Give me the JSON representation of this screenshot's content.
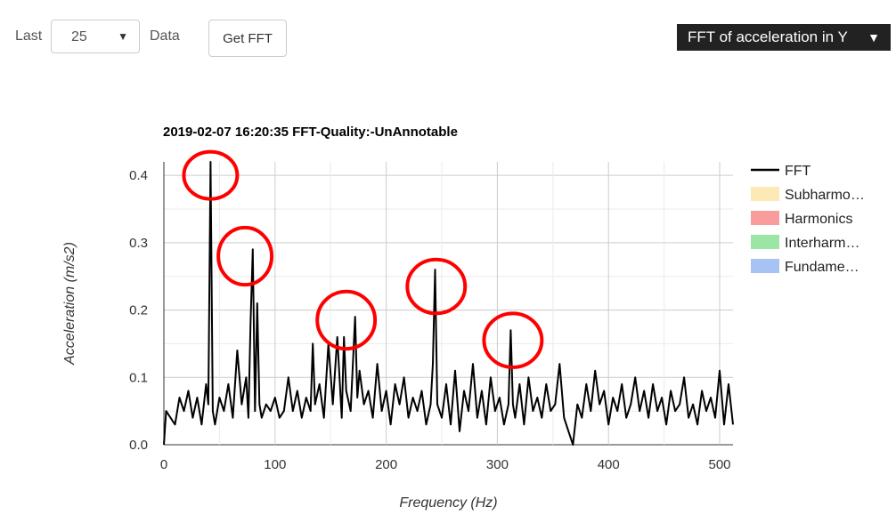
{
  "toolbar": {
    "last_label": "Last",
    "count_value": "25",
    "data_label": "Data",
    "get_fft_label": "Get FFT",
    "view_selector_label": "FFT of acceleration in Y"
  },
  "chart_data": {
    "type": "line",
    "title": "2019-02-07 16:20:35 FFT-Quality:-UnAnnotable",
    "xlabel": "Frequency (Hz)",
    "ylabel": "Acceleration (m/s2)",
    "xlim": [
      0,
      512
    ],
    "ylim": [
      0,
      0.42
    ],
    "xticks": [
      0,
      100,
      200,
      300,
      400,
      500
    ],
    "xtick_labels": [
      "0",
      "100",
      "200",
      "300",
      "400",
      "500"
    ],
    "yticks": [
      0.0,
      0.1,
      0.2,
      0.3,
      0.4
    ],
    "ytick_labels": [
      "0.0",
      "0.1",
      "0.2",
      "0.3",
      "0.4"
    ],
    "grid": true,
    "legend_position": "right",
    "legend": [
      {
        "name": "FFT",
        "kind": "line",
        "color": "#000000"
      },
      {
        "name": "Subharmo…",
        "kind": "box",
        "color": "#fde9b6"
      },
      {
        "name": "Harmonics",
        "kind": "box",
        "color": "#fb9c9c"
      },
      {
        "name": "Interharm…",
        "kind": "box",
        "color": "#9be6a5"
      },
      {
        "name": "Fundame…",
        "kind": "box",
        "color": "#a7c3f3"
      }
    ],
    "series": [
      {
        "name": "FFT",
        "color": "#000000",
        "x": [
          0,
          2,
          6,
          10,
          14,
          18,
          22,
          26,
          30,
          34,
          38,
          40,
          42,
          44,
          46,
          50,
          54,
          58,
          62,
          66,
          70,
          74,
          76,
          78,
          80,
          82,
          84,
          86,
          88,
          92,
          96,
          100,
          104,
          108,
          112,
          116,
          120,
          124,
          128,
          132,
          134,
          136,
          140,
          144,
          148,
          152,
          156,
          160,
          162,
          164,
          168,
          172,
          174,
          176,
          180,
          184,
          188,
          192,
          196,
          200,
          204,
          208,
          212,
          216,
          220,
          224,
          228,
          232,
          236,
          240,
          242,
          244,
          246,
          250,
          254,
          258,
          262,
          266,
          270,
          274,
          278,
          282,
          286,
          290,
          294,
          298,
          302,
          306,
          310,
          312,
          314,
          316,
          320,
          324,
          328,
          332,
          336,
          340,
          344,
          348,
          352,
          356,
          360,
          364,
          368,
          372,
          376,
          380,
          384,
          388,
          392,
          396,
          400,
          404,
          408,
          412,
          416,
          420,
          424,
          428,
          432,
          436,
          440,
          444,
          448,
          452,
          456,
          460,
          464,
          468,
          472,
          476,
          480,
          484,
          488,
          492,
          496,
          500,
          504,
          508,
          512
        ],
        "values": [
          0.0,
          0.05,
          0.04,
          0.03,
          0.07,
          0.05,
          0.08,
          0.04,
          0.07,
          0.03,
          0.09,
          0.06,
          0.42,
          0.05,
          0.03,
          0.07,
          0.05,
          0.09,
          0.04,
          0.14,
          0.06,
          0.1,
          0.04,
          0.18,
          0.29,
          0.05,
          0.21,
          0.06,
          0.04,
          0.06,
          0.05,
          0.07,
          0.04,
          0.05,
          0.1,
          0.05,
          0.08,
          0.04,
          0.07,
          0.05,
          0.15,
          0.06,
          0.09,
          0.04,
          0.15,
          0.06,
          0.16,
          0.04,
          0.16,
          0.08,
          0.05,
          0.19,
          0.07,
          0.11,
          0.06,
          0.08,
          0.04,
          0.12,
          0.05,
          0.08,
          0.03,
          0.09,
          0.06,
          0.1,
          0.04,
          0.07,
          0.05,
          0.08,
          0.03,
          0.06,
          0.12,
          0.26,
          0.06,
          0.04,
          0.09,
          0.03,
          0.11,
          0.02,
          0.08,
          0.05,
          0.12,
          0.04,
          0.08,
          0.03,
          0.1,
          0.05,
          0.07,
          0.03,
          0.06,
          0.17,
          0.06,
          0.04,
          0.09,
          0.03,
          0.1,
          0.05,
          0.07,
          0.04,
          0.09,
          0.05,
          0.06,
          0.12,
          0.04,
          0.02,
          0.0,
          0.06,
          0.04,
          0.09,
          0.05,
          0.11,
          0.06,
          0.08,
          0.03,
          0.07,
          0.05,
          0.09,
          0.04,
          0.06,
          0.1,
          0.05,
          0.08,
          0.04,
          0.09,
          0.05,
          0.07,
          0.03,
          0.08,
          0.05,
          0.06,
          0.1,
          0.04,
          0.06,
          0.03,
          0.08,
          0.05,
          0.07,
          0.04,
          0.11,
          0.03,
          0.09,
          0.03
        ]
      }
    ],
    "annotations": [
      {
        "shape": "ellipse",
        "color": "#ff0000",
        "center": [
          42,
          0.4
        ],
        "span_x": 48,
        "span_y": 0.07
      },
      {
        "shape": "ellipse",
        "color": "#ff0000",
        "center": [
          73,
          0.28
        ],
        "span_x": 48,
        "span_y": 0.085
      },
      {
        "shape": "ellipse",
        "color": "#ff0000",
        "center": [
          164,
          0.185
        ],
        "span_x": 52,
        "span_y": 0.085
      },
      {
        "shape": "ellipse",
        "color": "#ff0000",
        "center": [
          245,
          0.235
        ],
        "span_x": 52,
        "span_y": 0.08
      },
      {
        "shape": "ellipse",
        "color": "#ff0000",
        "center": [
          314,
          0.155
        ],
        "span_x": 52,
        "span_y": 0.08
      }
    ]
  }
}
